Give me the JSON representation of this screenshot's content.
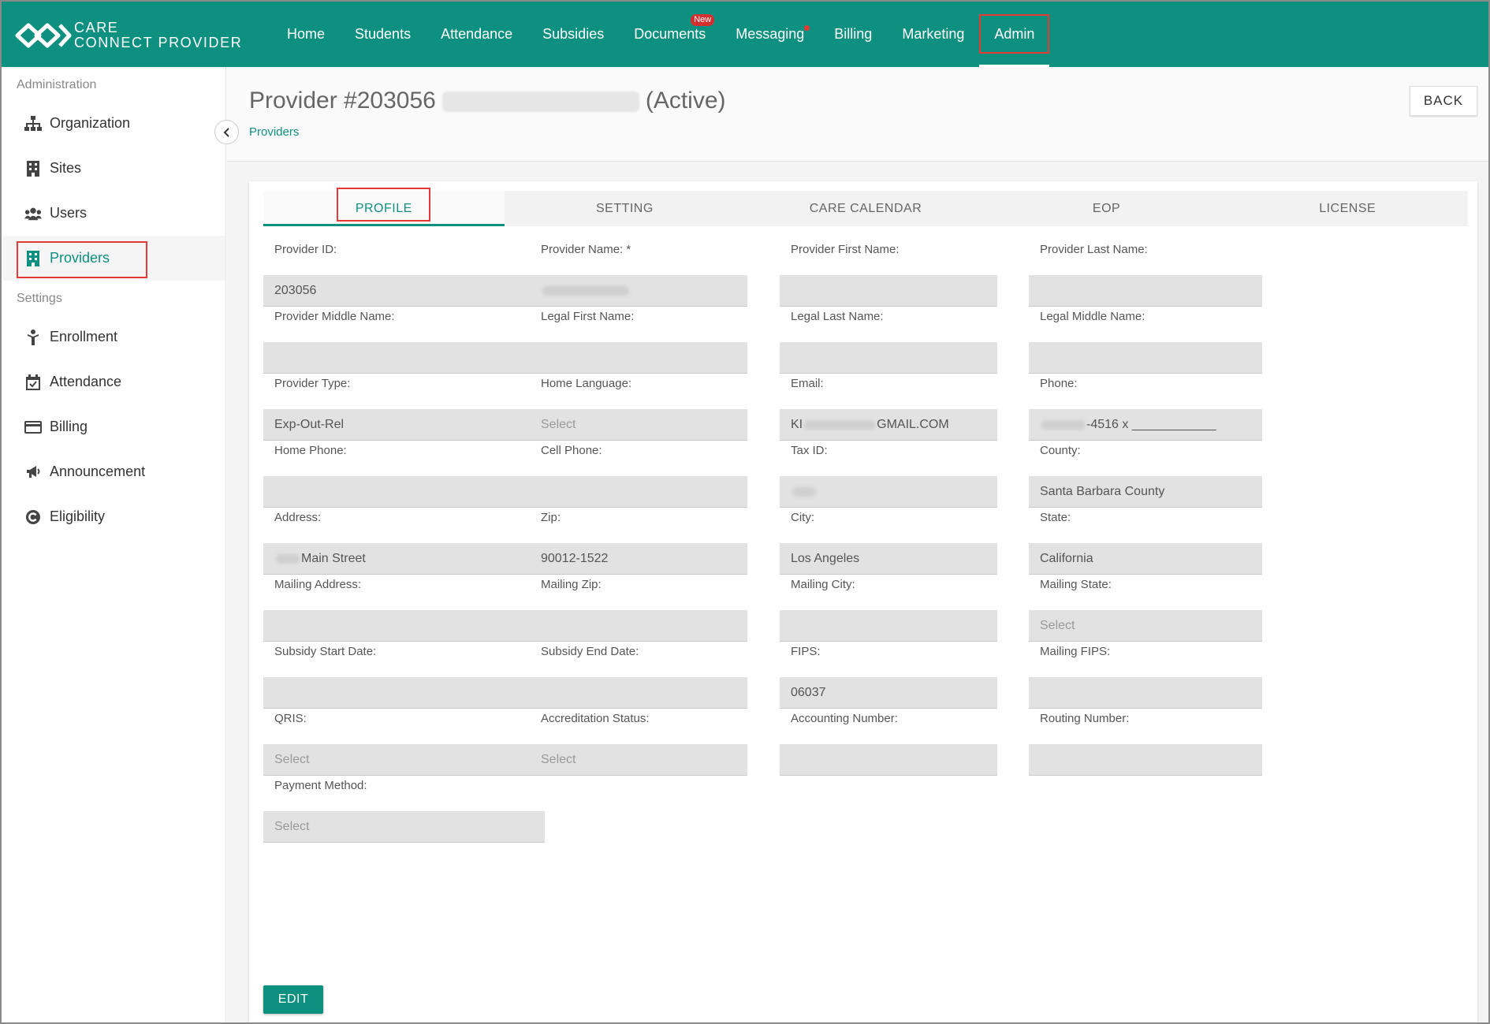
{
  "brand": {
    "line1": "CARE",
    "line2": "CONNECT PROVIDER"
  },
  "nav": {
    "items": [
      {
        "label": "Home"
      },
      {
        "label": "Students"
      },
      {
        "label": "Attendance"
      },
      {
        "label": "Subsidies"
      },
      {
        "label": "Documents",
        "badge": "New"
      },
      {
        "label": "Messaging"
      },
      {
        "label": "Billing"
      },
      {
        "label": "Marketing"
      },
      {
        "label": "Admin"
      }
    ]
  },
  "sidebar": {
    "admin_heading": "Administration",
    "admin_items": [
      {
        "label": "Organization",
        "icon": "sitemap-icon"
      },
      {
        "label": "Sites",
        "icon": "building-icon"
      },
      {
        "label": "Users",
        "icon": "users-icon"
      },
      {
        "label": "Providers",
        "icon": "building-icon"
      }
    ],
    "settings_heading": "Settings",
    "settings_items": [
      {
        "label": "Enrollment",
        "icon": "child-icon"
      },
      {
        "label": "Attendance",
        "icon": "calendar-check-icon"
      },
      {
        "label": "Billing",
        "icon": "credit-card-icon"
      },
      {
        "label": "Announcement",
        "icon": "bullhorn-icon"
      },
      {
        "label": "Eligibility",
        "icon": "copyright-icon"
      }
    ]
  },
  "page": {
    "title_prefix": "Provider #203056",
    "title_suffix": "(Active)",
    "breadcrumb": "Providers",
    "back_label": "BACK"
  },
  "tabs": [
    "PROFILE",
    "SETTING",
    "CARE CALENDAR",
    "EOP",
    "LICENSE"
  ],
  "fields": [
    {
      "label": "Provider ID:",
      "value": "203056"
    },
    {
      "label": "Provider Name: *",
      "value": ""
    },
    {
      "label": "Provider First Name:",
      "value": ""
    },
    {
      "label": "Provider Last Name:",
      "value": ""
    },
    {
      "label": "Provider Middle Name:",
      "value": ""
    },
    {
      "label": "Legal First Name:",
      "value": ""
    },
    {
      "label": "Legal Last Name:",
      "value": ""
    },
    {
      "label": "Legal Middle Name:",
      "value": ""
    },
    {
      "label": "Provider Type:",
      "value": "Exp-Out-Rel"
    },
    {
      "label": "Home Language:",
      "placeholder": "Select"
    },
    {
      "label": "Email:",
      "value": "KI",
      "value_suffix": "GMAIL.COM"
    },
    {
      "label": "Phone:",
      "value": "",
      "value_suffix": "-4516 x ____________"
    },
    {
      "label": "Home Phone:",
      "value": ""
    },
    {
      "label": "Cell Phone:",
      "value": ""
    },
    {
      "label": "Tax ID:",
      "value": ""
    },
    {
      "label": "County:",
      "value": "Santa Barbara County"
    },
    {
      "label": "Address:",
      "value": "",
      "value_suffix": "Main Street"
    },
    {
      "label": "Zip:",
      "value": "90012-1522"
    },
    {
      "label": "City:",
      "value": "Los Angeles"
    },
    {
      "label": "State:",
      "value": "California"
    },
    {
      "label": "Mailing Address:",
      "value": ""
    },
    {
      "label": "Mailing Zip:",
      "value": ""
    },
    {
      "label": "Mailing City:",
      "value": ""
    },
    {
      "label": "Mailing State:",
      "placeholder": "Select"
    },
    {
      "label": "Subsidy Start Date:",
      "value": ""
    },
    {
      "label": "Subsidy End Date:",
      "value": ""
    },
    {
      "label": "FIPS:",
      "value": "06037"
    },
    {
      "label": "Mailing FIPS:",
      "value": ""
    },
    {
      "label": "QRIS:",
      "placeholder": "Select"
    },
    {
      "label": "Accreditation Status:",
      "placeholder": "Select"
    },
    {
      "label": "Accounting Number:",
      "value": ""
    },
    {
      "label": "Routing Number:",
      "value": ""
    },
    {
      "label": "Payment Method:",
      "placeholder": "Select"
    }
  ],
  "edit_label": "EDIT",
  "colors": {
    "brand": "#0e9080",
    "highlight": "#e53935"
  }
}
